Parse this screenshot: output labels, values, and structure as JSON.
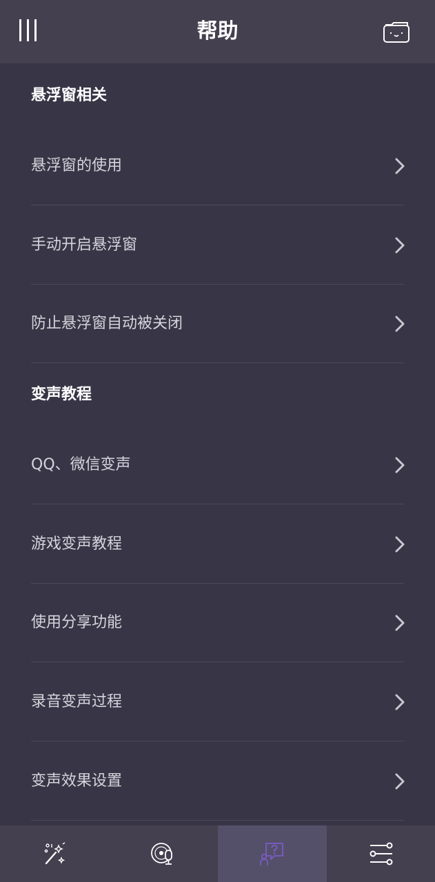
{
  "header": {
    "title": "帮助",
    "menu_icon": "hamburger-icon",
    "folder_icon": "folder-face-icon"
  },
  "sections": [
    {
      "title": "悬浮窗相关",
      "items": [
        {
          "label": "悬浮窗的使用"
        },
        {
          "label": "手动开启悬浮窗"
        },
        {
          "label": "防止悬浮窗自动被关闭"
        }
      ]
    },
    {
      "title": "变声教程",
      "items": [
        {
          "label": "QQ、微信变声"
        },
        {
          "label": "游戏变声教程"
        },
        {
          "label": "使用分享功能"
        },
        {
          "label": "录音变声过程"
        },
        {
          "label": "变声效果设置"
        }
      ]
    }
  ],
  "bottom_nav": {
    "tabs": [
      {
        "icon": "magic-wand-icon",
        "active": false
      },
      {
        "icon": "record-microphone-icon",
        "active": false
      },
      {
        "icon": "help-chat-icon",
        "active": true
      },
      {
        "icon": "settings-sliders-icon",
        "active": false
      }
    ]
  },
  "colors": {
    "background": "#383546",
    "header": "#44404f",
    "active_tab": "#55506a",
    "accent": "#7b5cc9",
    "text": "#d6d4dc"
  }
}
